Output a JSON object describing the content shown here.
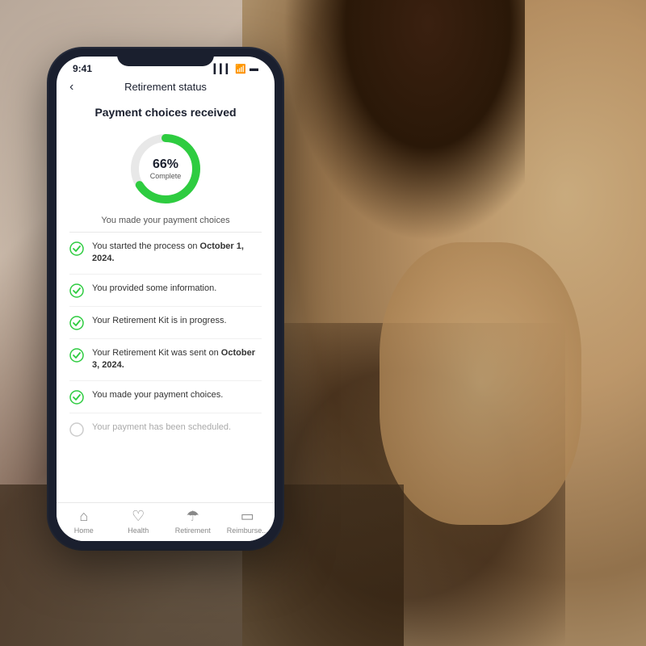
{
  "background": {
    "colors": [
      "#b8a89a",
      "#8a7060",
      "#c9b8a8"
    ]
  },
  "phone": {
    "status_bar": {
      "time": "9:41",
      "signal": "▎▎▎",
      "wifi": "wifi",
      "battery": "battery"
    },
    "nav": {
      "back_icon": "‹",
      "title": "Retirement status"
    },
    "section": {
      "title": "Payment choices received"
    },
    "donut": {
      "percent": "66%",
      "label": "Complete",
      "subtitle": "You made your payment choices",
      "value": 66,
      "color_filled": "#2ecc40",
      "color_empty": "#e8e8e8"
    },
    "timeline_items": [
      {
        "text": "You started the process on ",
        "bold": "October 1, 2024.",
        "checked": true
      },
      {
        "text": "You provided some information.",
        "bold": "",
        "checked": true
      },
      {
        "text": "Your Retirement Kit is in progress.",
        "bold": "",
        "checked": true
      },
      {
        "text": "Your Retirement Kit was sent on ",
        "bold": "October 3, 2024.",
        "checked": true
      },
      {
        "text": "You made your payment choices.",
        "bold": "",
        "checked": true
      },
      {
        "text": "Your payment has been scheduled.",
        "bold": "",
        "checked": false
      }
    ],
    "bottom_nav": [
      {
        "icon": "⌂",
        "label": "Home"
      },
      {
        "icon": "♡",
        "label": "Health"
      },
      {
        "icon": "☂",
        "label": "Retirement"
      },
      {
        "icon": "▭",
        "label": "Reimburse..."
      }
    ]
  }
}
